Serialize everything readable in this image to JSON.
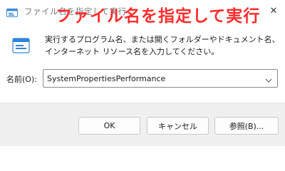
{
  "window": {
    "title": "ファイル名を指定して実行",
    "overlay_title": "ファイル名を指定して実行",
    "close_glyph": "✕"
  },
  "description": "実行するプログラム名、または開くフォルダーやドキュメント名、インターネット リソース名を入力してください。",
  "open_field": {
    "label": "名前(O):",
    "value": "SystemPropertiesPerformance"
  },
  "buttons": {
    "ok": "OK",
    "cancel": "キャンセル",
    "browse": "参照(B)..."
  },
  "icons": {
    "app": "run-dialog-icon",
    "run": "run-dialog-icon",
    "close": "close-icon",
    "dropdown": "chevron-down-icon"
  },
  "colors": {
    "overlay_title": "#ff2d2d",
    "accent": "#0067c0",
    "footer_bg": "#f0f0f0"
  }
}
